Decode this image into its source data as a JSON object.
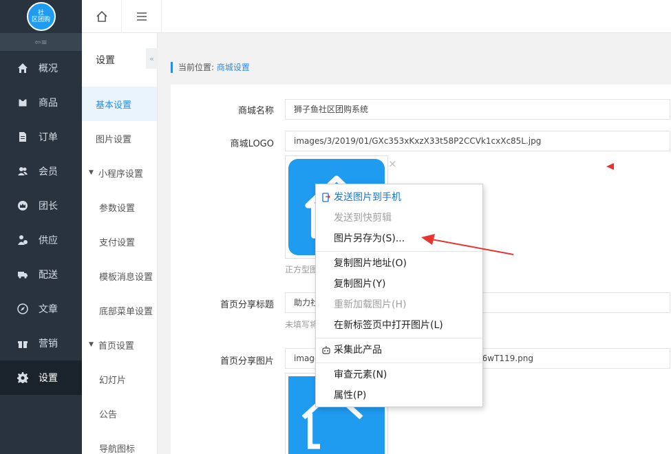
{
  "logo": {
    "line1": "社",
    "line2": "区团购"
  },
  "sidebar": {
    "collapse_icon": "collapse-left-icon",
    "items": [
      {
        "label": "概况",
        "icon": "home-icon"
      },
      {
        "label": "商品",
        "icon": "bag-icon"
      },
      {
        "label": "订单",
        "icon": "file-icon"
      },
      {
        "label": "会员",
        "icon": "users-icon"
      },
      {
        "label": "团长",
        "icon": "crown-icon"
      },
      {
        "label": "供应",
        "icon": "supplier-icon"
      },
      {
        "label": "配送",
        "icon": "truck-icon"
      },
      {
        "label": "文章",
        "icon": "compass-icon"
      },
      {
        "label": "营销",
        "icon": "gift-icon"
      },
      {
        "label": "设置",
        "icon": "gear-icon"
      }
    ],
    "active": "设置"
  },
  "subnav": {
    "title": "设置",
    "toggle": "«",
    "items": [
      {
        "label": "基本设置",
        "active": true
      },
      {
        "label": "图片设置"
      },
      {
        "label": "小程序设置",
        "group": true
      },
      {
        "label": "参数设置"
      },
      {
        "label": "支付设置"
      },
      {
        "label": "模板消息设置"
      },
      {
        "label": "底部菜单设置"
      },
      {
        "label": "首页设置",
        "group": true
      },
      {
        "label": "幻灯片"
      },
      {
        "label": "公告"
      },
      {
        "label": "导航图标"
      }
    ]
  },
  "breadcrumb": {
    "prefix": "当前位置:",
    "current": "商城设置"
  },
  "form": {
    "shop_name_label": "商城名称",
    "shop_name_value": "狮子鱼社区团购系统",
    "logo_label": "商城LOGO",
    "logo_value": "images/3/2019/01/GXc353xKxzX33t58P2CCVk1cxXc85L.jpg",
    "logo_hint": "正方型图",
    "share_title_label": "首页分享标题",
    "share_title_value": "助力社",
    "share_title_hint": "未填写将",
    "share_image_label": "首页分享图片",
    "share_image_value_start": "image",
    "share_image_value_end": "16wT119.png",
    "close_symbol": "×"
  },
  "context_menu": {
    "items": [
      {
        "label": "发送图片到手机",
        "style": "blue",
        "icon": "phone-send-icon"
      },
      {
        "label": "发送到快剪辑",
        "style": "disabled"
      },
      {
        "label": "图片另存为(S)..."
      },
      {
        "label": "复制图片地址(O)"
      },
      {
        "label": "复制图片(Y)"
      },
      {
        "label": "重新加载图片(H)",
        "style": "disabled"
      },
      {
        "label": "在新标签页中打开图片(L)"
      },
      {
        "label": "采集此产品",
        "icon": "robot-icon"
      },
      {
        "label": "审查元素(N)"
      },
      {
        "label": "属性(P)"
      }
    ]
  },
  "colors": {
    "sidebar": "#28333e",
    "accent": "#2b8ce4",
    "arrow": "#e8332f"
  }
}
